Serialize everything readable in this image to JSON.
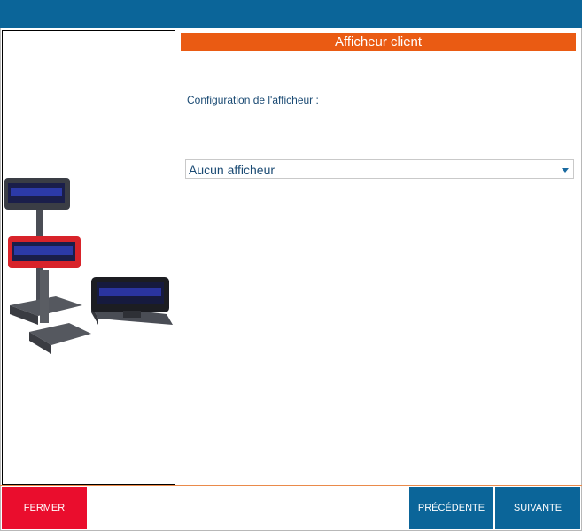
{
  "section": {
    "title": "Afficheur client"
  },
  "config": {
    "label": "Configuration de l'afficheur :",
    "selected": "Aucun afficheur"
  },
  "buttons": {
    "close": "FERMER",
    "previous": "PRÉCÉDENTE",
    "next": "SUIVANTE"
  },
  "colors": {
    "header": "#0b6599",
    "accent": "#ea5b13",
    "close": "#ea0d2d",
    "nav": "#0b6599"
  },
  "icons": {
    "dropdown": "chevron-down-icon",
    "illustration": "customer-display-illustration"
  }
}
